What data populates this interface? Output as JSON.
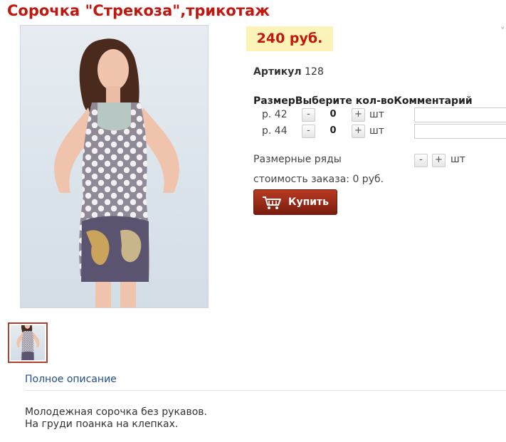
{
  "product": {
    "title": "Сорочка \"Стрекоза\",трикотаж",
    "price": "240 руб.",
    "article_label": "Артикул",
    "article_value": "128"
  },
  "sizes_table": {
    "header": "РазмерВыберите кол-воКомментарий",
    "rows": [
      {
        "size": "р. 42",
        "minus": "-",
        "qty": "0",
        "plus": "+",
        "unit": "шт"
      },
      {
        "size": "р. 44",
        "minus": "-",
        "qty": "0",
        "plus": "+",
        "unit": "шт"
      }
    ]
  },
  "size_ranges": {
    "label": "Размерные ряды",
    "minus": "-",
    "plus": "+",
    "unit": "шт"
  },
  "order": {
    "cost_text": "стоимость заказа: 0 руб.",
    "buy_label": "Купить"
  },
  "description": {
    "link": "Полное описание",
    "lines": [
      "Молодежная сорочка без рукавов.",
      "На груди поанка на клепках."
    ]
  },
  "colors": {
    "title": "#c0170f",
    "price_bg": "#fbf3b7",
    "buy_button": "#9a2a17",
    "link": "#1f4f86"
  }
}
